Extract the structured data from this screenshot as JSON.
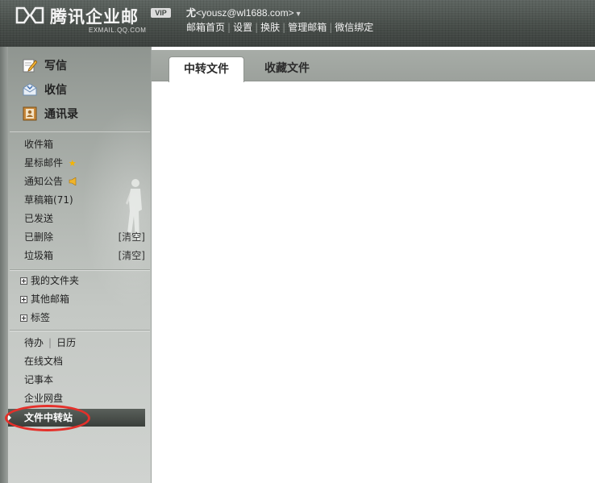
{
  "header": {
    "brand_name": "腾讯企业邮",
    "brand_sub": "EXMAIL.QQ.COM",
    "vip_label": "VIP",
    "user_name": "尤",
    "user_email": "<yousz@wl1688.com>",
    "account_arrow": "▼",
    "links": [
      "邮箱首页",
      "设置",
      "换肤",
      "管理邮箱",
      "微信绑定"
    ]
  },
  "sidebar": {
    "actions": [
      {
        "label": "写信",
        "icon": "write-icon"
      },
      {
        "label": "收信",
        "icon": "inbox-icon"
      },
      {
        "label": "通讯录",
        "icon": "contacts-icon"
      }
    ],
    "folders": [
      {
        "label": "收件箱"
      },
      {
        "label": "星标邮件",
        "icon": "star-icon"
      },
      {
        "label": "通知公告",
        "icon": "megaphone-icon"
      },
      {
        "label": "草稿箱",
        "count": "(71)"
      },
      {
        "label": "已发送"
      },
      {
        "label": "已删除",
        "action": "[清空]"
      },
      {
        "label": "垃圾箱",
        "action": "[清空]"
      }
    ],
    "trees": [
      {
        "label": "我的文件夹"
      },
      {
        "label": "其他邮箱"
      },
      {
        "label": "标签"
      }
    ],
    "todo": "待办",
    "calendar": "日历",
    "tools": [
      "在线文档",
      "记事本",
      "企业网盘"
    ],
    "selected": "文件中转站"
  },
  "main": {
    "tabs": [
      {
        "label": "中转文件",
        "active": true
      },
      {
        "label": "收藏文件",
        "active": false
      }
    ]
  },
  "colors": {
    "header_bg": "#474d49",
    "sidebar_bg": "#b0b5b0",
    "selected_bg": "#3a3f3b",
    "highlight_circle": "#e4302a",
    "star": "#f5b400"
  }
}
